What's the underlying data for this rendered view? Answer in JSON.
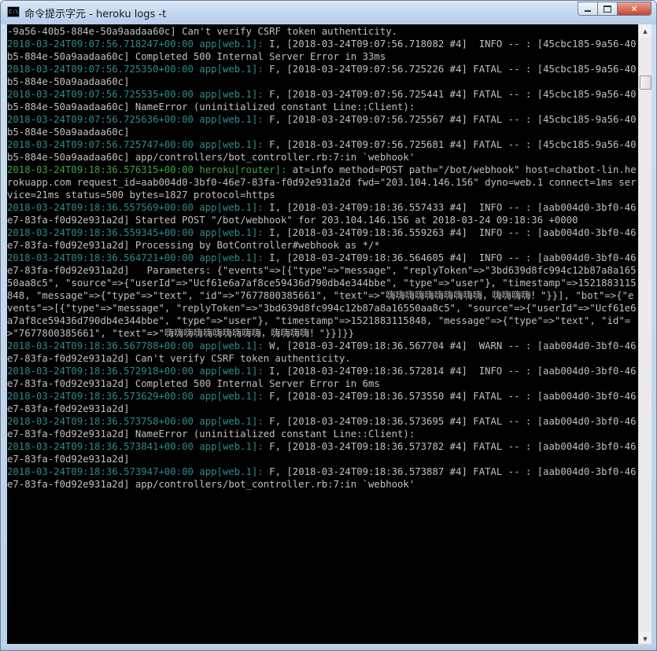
{
  "window": {
    "title": "命令提示字元 - heroku  logs -t",
    "icon_text": "C:\\",
    "buttons": {
      "minimize": "minimize-icon",
      "maximize": "maximize-icon",
      "close": "✕"
    }
  },
  "scrollbar": {
    "up_arrow": "▲",
    "down_arrow": "▼"
  },
  "colors": {
    "timestamp": "#2a8c8c",
    "router": "#3aa83a",
    "text": "#c0c0c0",
    "background": "#000000"
  },
  "log_lines": [
    {
      "ts": "",
      "src": "",
      "msg": "-9a56-40b5-884e-50a9aadaa60c] Can't verify CSRF token authenticity."
    },
    {
      "ts": "2018-03-24T09:07:56.718247+00:00",
      "src": "app[web.1]:",
      "msg": "I, [2018-03-24T09:07:56.718082 #4]  INFO -- : [45cbc185-9a56-40b5-884e-50a9aadaa60c] Completed 500 Internal Server Error in 33ms"
    },
    {
      "ts": "2018-03-24T09:07:56.725350+00:00",
      "src": "app[web.1]:",
      "msg": "F, [2018-03-24T09:07:56.725226 #4] FATAL -- : [45cbc185-9a56-40b5-884e-50a9aadaa60c]"
    },
    {
      "ts": "2018-03-24T09:07:56.725535+00:00",
      "src": "app[web.1]:",
      "msg": "F, [2018-03-24T09:07:56.725441 #4] FATAL -- : [45cbc185-9a56-40b5-884e-50a9aadaa60c] NameError (uninitialized constant Line::Client):"
    },
    {
      "ts": "2018-03-24T09:07:56.725636+00:00",
      "src": "app[web.1]:",
      "msg": "F, [2018-03-24T09:07:56.725567 #4] FATAL -- : [45cbc185-9a56-40b5-884e-50a9aadaa60c]"
    },
    {
      "ts": "2018-03-24T09:07:56.725747+00:00",
      "src": "app[web.1]:",
      "msg": "F, [2018-03-24T09:07:56.725681 #4] FATAL -- : [45cbc185-9a56-40b5-884e-50a9aadaa60c] app/controllers/bot_controller.rb:7:in `webhook'"
    },
    {
      "ts": "2018-03-24T09:18:36.576315+00:00",
      "src": "heroku[router]:",
      "router": true,
      "msg": "at=info method=POST path=\"/bot/webhook\" host=chatbot-lin.herokuapp.com request_id=aab004d0-3bf0-46e7-83fa-f0d92e931a2d fwd=\"203.104.146.156\" dyno=web.1 connect=1ms service=21ms status=500 bytes=1827 protocol=https"
    },
    {
      "ts": "2018-03-24T09:18:36.557569+00:00",
      "src": "app[web.1]:",
      "msg": "I, [2018-03-24T09:18:36.557433 #4]  INFO -- : [aab004d0-3bf0-46e7-83fa-f0d92e931a2d] Started POST \"/bot/webhook\" for 203.104.146.156 at 2018-03-24 09:18:36 +0000"
    },
    {
      "ts": "2018-03-24T09:18:36.559345+00:00",
      "src": "app[web.1]:",
      "msg": "I, [2018-03-24T09:18:36.559263 #4]  INFO -- : [aab004d0-3bf0-46e7-83fa-f0d92e931a2d] Processing by BotController#webhook as */*"
    },
    {
      "ts": "2018-03-24T09:18:36.564721+00:00",
      "src": "app[web.1]:",
      "msg": "I, [2018-03-24T09:18:36.564605 #4]  INFO -- : [aab004d0-3bf0-46e7-83fa-f0d92e931a2d]   Parameters: {\"events\"=>[{\"type\"=>\"message\", \"replyToken\"=>\"3bd639d8fc994c12b87a8a16550aa8c5\", \"source\"=>{\"userId\"=>\"Ucf61e6a7af8ce59436d790db4e344bbe\", \"type\"=>\"user\"}, \"timestamp\"=>1521883115848, \"message\"=>{\"type\"=>\"text\", \"id\"=>\"7677800385661\", \"text\"=>\"嗨嗨嗨嗨嗨嗨嗨嗨嗨嗨，嗨嗨嗨嗨！\"}}], \"bot\"=>{\"events\"=>[{\"type\"=>\"message\", \"replyToken\"=>\"3bd639d8fc994c12b87a8a16550aa8c5\", \"source\"=>{\"userId\"=>\"Ucf61e6a7af8ce59436d790db4e344bbe\", \"type\"=>\"user\"}, \"timestamp\"=>1521883115848, \"message\"=>{\"type\"=>\"text\", \"id\"=>\"7677800385661\", \"text\"=>\"嗨嗨嗨嗨嗨嗨嗨嗨嗨嗨，嗨嗨嗨嗨！\"}}]}}"
    },
    {
      "ts": "2018-03-24T09:18:36.567788+00:00",
      "src": "app[web.1]:",
      "msg": "W, [2018-03-24T09:18:36.567704 #4]  WARN -- : [aab004d0-3bf0-46e7-83fa-f0d92e931a2d] Can't verify CSRF token authenticity."
    },
    {
      "ts": "2018-03-24T09:18:36.572918+00:00",
      "src": "app[web.1]:",
      "msg": "I, [2018-03-24T09:18:36.572814 #4]  INFO -- : [aab004d0-3bf0-46e7-83fa-f0d92e931a2d] Completed 500 Internal Server Error in 6ms"
    },
    {
      "ts": "2018-03-24T09:18:36.573629+00:00",
      "src": "app[web.1]:",
      "msg": "F, [2018-03-24T09:18:36.573550 #4] FATAL -- : [aab004d0-3bf0-46e7-83fa-f0d92e931a2d]"
    },
    {
      "ts": "2018-03-24T09:18:36.573758+00:00",
      "src": "app[web.1]:",
      "msg": "F, [2018-03-24T09:18:36.573695 #4] FATAL -- : [aab004d0-3bf0-46e7-83fa-f0d92e931a2d] NameError (uninitialized constant Line::Client):"
    },
    {
      "ts": "2018-03-24T09:18:36.573841+00:00",
      "src": "app[web.1]:",
      "msg": "F, [2018-03-24T09:18:36.573782 #4] FATAL -- : [aab004d0-3bf0-46e7-83fa-f0d92e931a2d]"
    },
    {
      "ts": "2018-03-24T09:18:36.573947+00:00",
      "src": "app[web.1]:",
      "msg": "F, [2018-03-24T09:18:36.573887 #4] FATAL -- : [aab004d0-3bf0-46e7-83fa-f0d92e931a2d] app/controllers/bot_controller.rb:7:in `webhook'"
    }
  ]
}
